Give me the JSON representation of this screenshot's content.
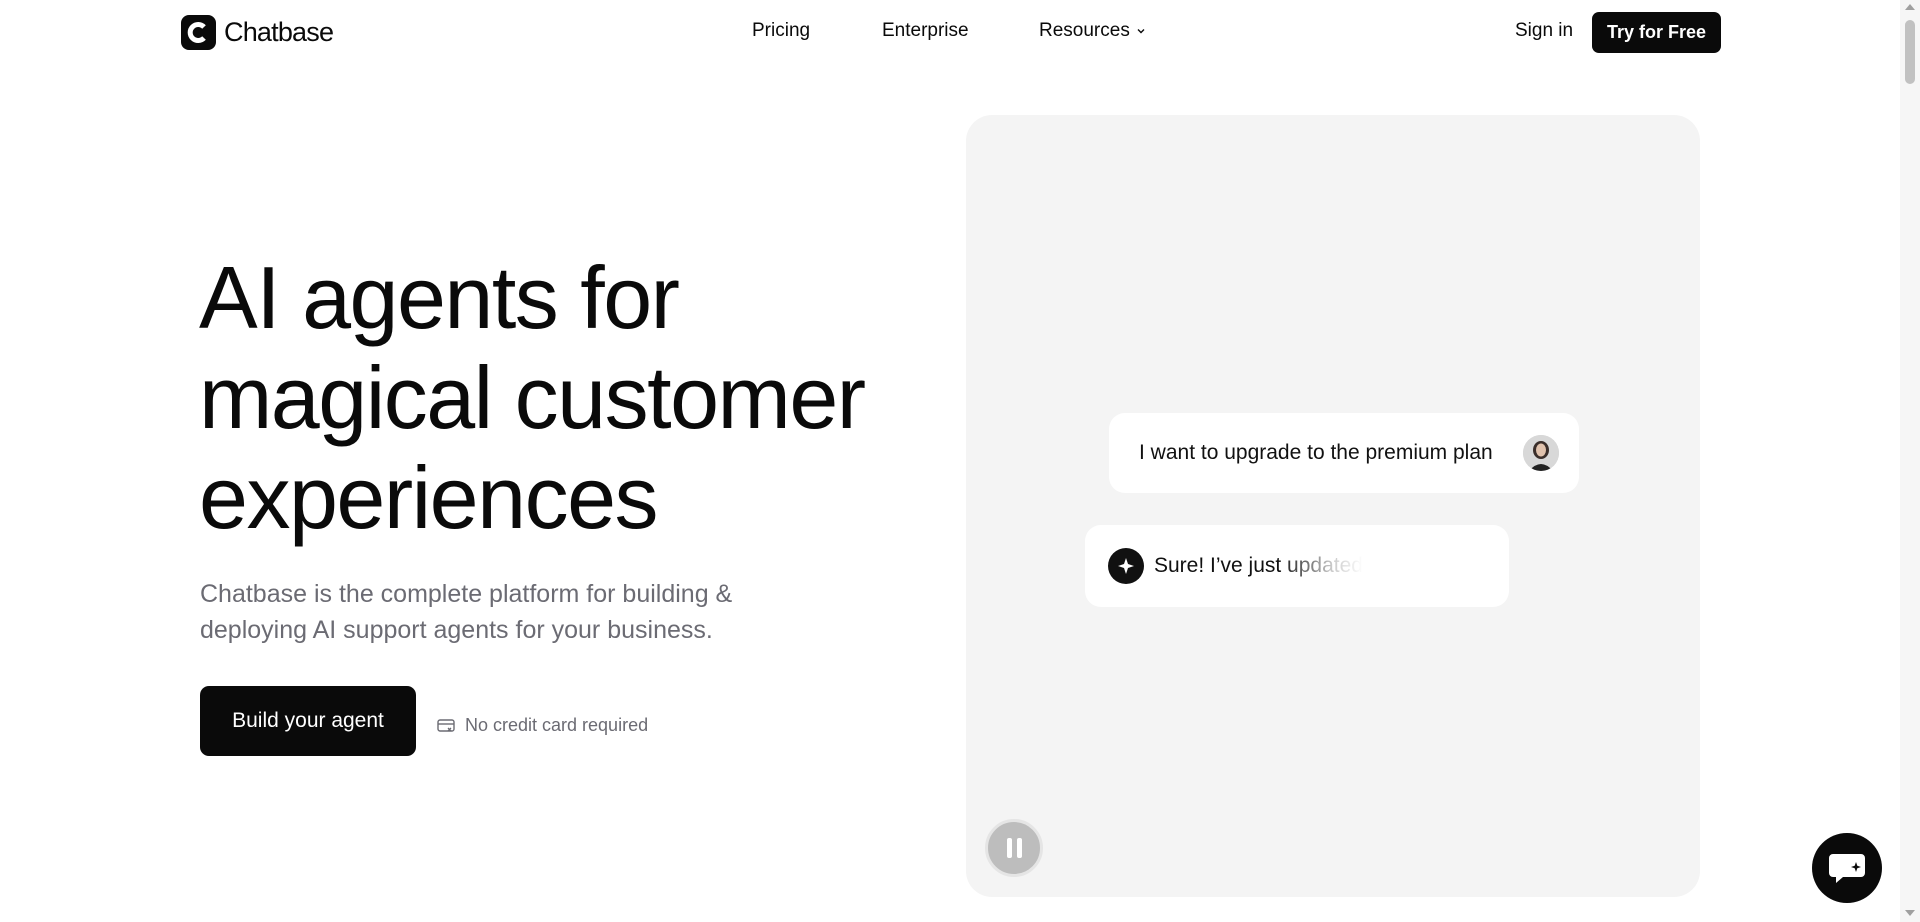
{
  "header": {
    "logo_text": "Chatbase",
    "nav": {
      "pricing": "Pricing",
      "enterprise": "Enterprise",
      "resources": "Resources"
    },
    "sign_in": "Sign in",
    "cta": "Try for Free"
  },
  "hero": {
    "title_lines": [
      "AI agents for",
      "magical customer",
      "experiences"
    ],
    "subtitle": "Chatbase is the complete platform for building & deploying AI support agents for your business.",
    "build_button": "Build your agent",
    "no_credit_card": "No credit card required"
  },
  "demo": {
    "user_message": "I want to upgrade to the premium plan",
    "bot_message": "Sure! I’ve just updated",
    "pause_icon": "pause-icon",
    "bot_icon": "sparkle-icon"
  },
  "chat_widget": {
    "icon": "chat-bubble-icon"
  },
  "colors": {
    "primary": "#0a0a0a",
    "muted_text": "#6b6b73",
    "panel_bg": "#f4f4f4",
    "gradient": [
      "#fb923c",
      "#f472b6",
      "#d946ef"
    ]
  }
}
